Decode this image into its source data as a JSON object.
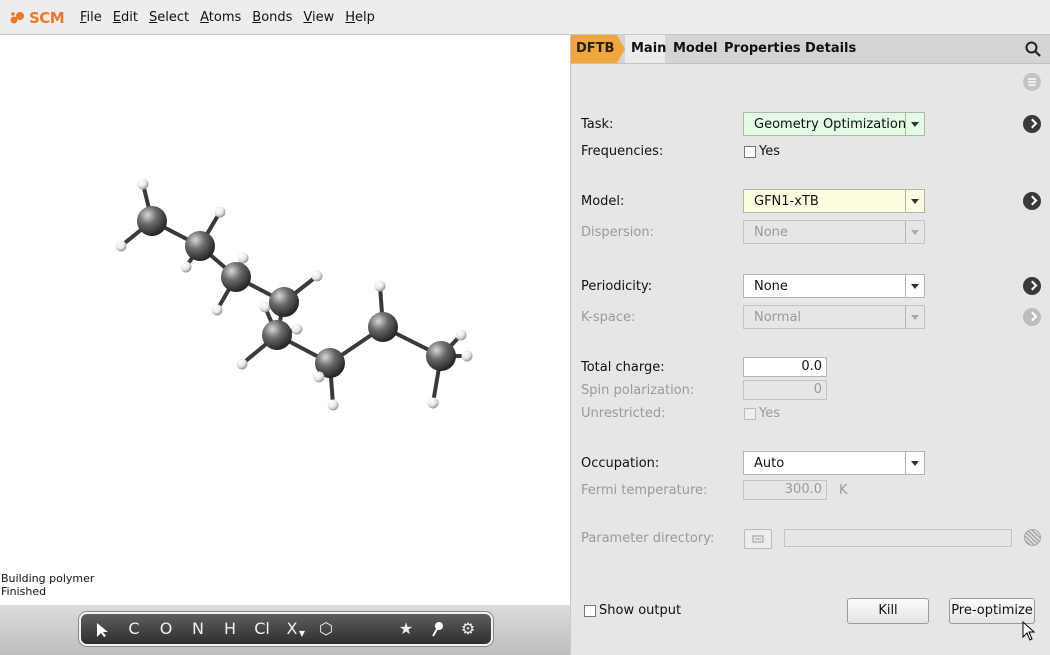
{
  "app": {
    "logo_text": "SCM",
    "brand_color": "#e8792b"
  },
  "menu": {
    "items": [
      {
        "first": "F",
        "rest": "ile"
      },
      {
        "first": "E",
        "rest": "dit"
      },
      {
        "first": "S",
        "rest": "elect"
      },
      {
        "first": "A",
        "rest": "toms"
      },
      {
        "first": "B",
        "rest": "onds"
      },
      {
        "first": "V",
        "rest": "iew"
      },
      {
        "first": "H",
        "rest": "elp"
      }
    ]
  },
  "viewport": {
    "status_line1": "Building polymer",
    "status_line2": "Finished"
  },
  "toolbar": {
    "tools": [
      "C",
      "O",
      "N",
      "H",
      "Cl",
      "X"
    ],
    "tool_icons": [
      "pointer-icon",
      "ring-icon",
      "star-icon",
      "pin-icon",
      "gear-icon"
    ]
  },
  "tabs": {
    "engine": "DFTB",
    "items": [
      "Main",
      "Model",
      "Properties",
      "Details"
    ],
    "active": "Main"
  },
  "form": {
    "task_label": "Task:",
    "task_value": "Geometry Optimization",
    "frequencies_label": "Frequencies:",
    "frequencies_option": "Yes",
    "model_label": "Model:",
    "model_value": "GFN1-xTB",
    "dispersion_label": "Dispersion:",
    "dispersion_value": "None",
    "periodicity_label": "Periodicity:",
    "periodicity_value": "None",
    "kspace_label": "K-space:",
    "kspace_value": "Normal",
    "total_charge_label": "Total charge:",
    "total_charge_value": "0.0",
    "spin_label": "Spin polarization:",
    "spin_value": "0",
    "unrestricted_label": "Unrestricted:",
    "unrestricted_option": "Yes",
    "occupation_label": "Occupation:",
    "occupation_value": "Auto",
    "fermi_label": "Fermi temperature:",
    "fermi_value": "300.0",
    "fermi_unit": "K",
    "param_dir_label": "Parameter directory:",
    "param_dir_value": ""
  },
  "bottom": {
    "show_output_label": "Show output",
    "kill_label": "Kill",
    "preoptimize_label": "Pre-optimize"
  },
  "colors": {
    "task_bg": "#e3fbe3",
    "model_bg": "#fdfde0",
    "tab_engine": "#f0a63c"
  }
}
